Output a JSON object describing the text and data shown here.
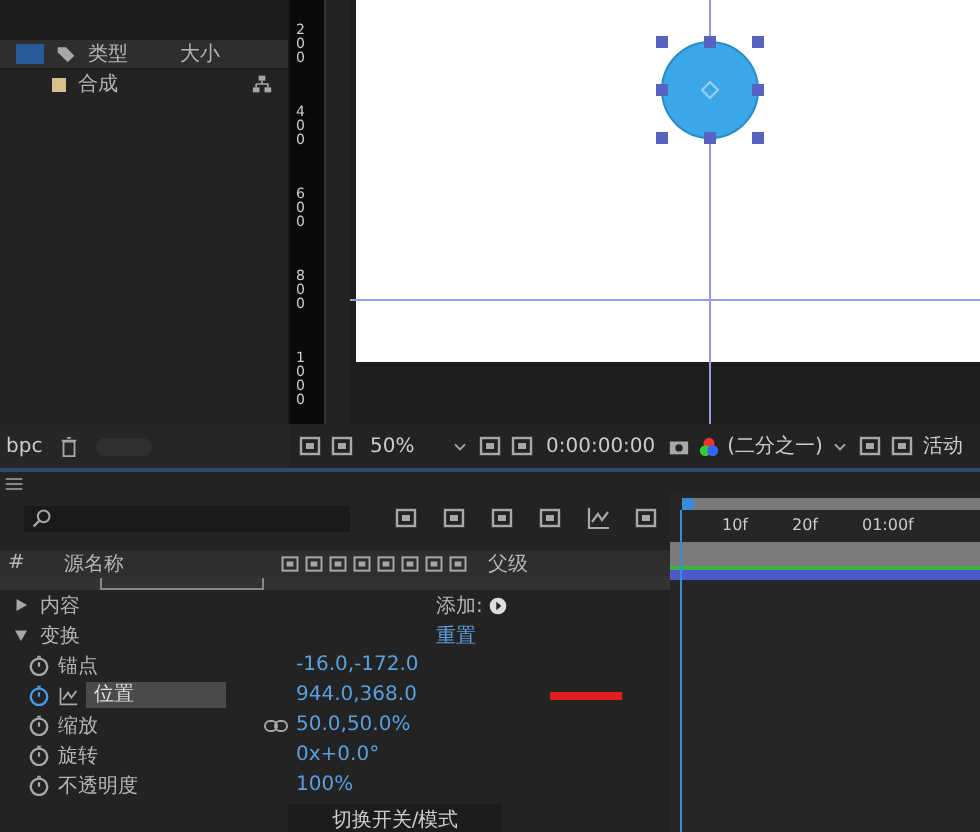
{
  "project_panel": {
    "columns": [
      "类型",
      "大小"
    ],
    "items": [
      {
        "name": "合成",
        "color": "#d8c08a"
      }
    ],
    "footer": "bpc"
  },
  "ruler": {
    "labels": [
      "200",
      "400",
      "600",
      "800",
      "1000"
    ]
  },
  "viewer_toolbar": {
    "zoom": "50%",
    "timecode": "0:00:00:00",
    "resolution": "(二分之一)",
    "view": "活动"
  },
  "timeline": {
    "columns": [
      "#",
      "源名称",
      "父级"
    ],
    "properties": [
      {
        "kind": "group",
        "label": "内容",
        "expanded": false,
        "value": "添加:"
      },
      {
        "kind": "group",
        "label": "变换",
        "expanded": true,
        "value": "重置"
      },
      {
        "kind": "property",
        "label": "锚点",
        "value": "-16.0,-172.0",
        "animated": false,
        "selected": false,
        "linked": false
      },
      {
        "kind": "property",
        "label": "位置",
        "value": "944.0,368.0",
        "animated": true,
        "selected": true,
        "linked": false
      },
      {
        "kind": "property",
        "label": "缩放",
        "value": "50.0,50.0%",
        "animated": false,
        "selected": false,
        "linked": true
      },
      {
        "kind": "property",
        "label": "旋转",
        "value": "0x+0.0°",
        "animated": false,
        "selected": false,
        "linked": false
      },
      {
        "kind": "property",
        "label": "不透明度",
        "value": "100%",
        "animated": false,
        "selected": false,
        "linked": false
      }
    ],
    "time_labels": [
      "10f",
      "20f",
      "01:00f"
    ],
    "footer_button": "切换开关/模式"
  }
}
